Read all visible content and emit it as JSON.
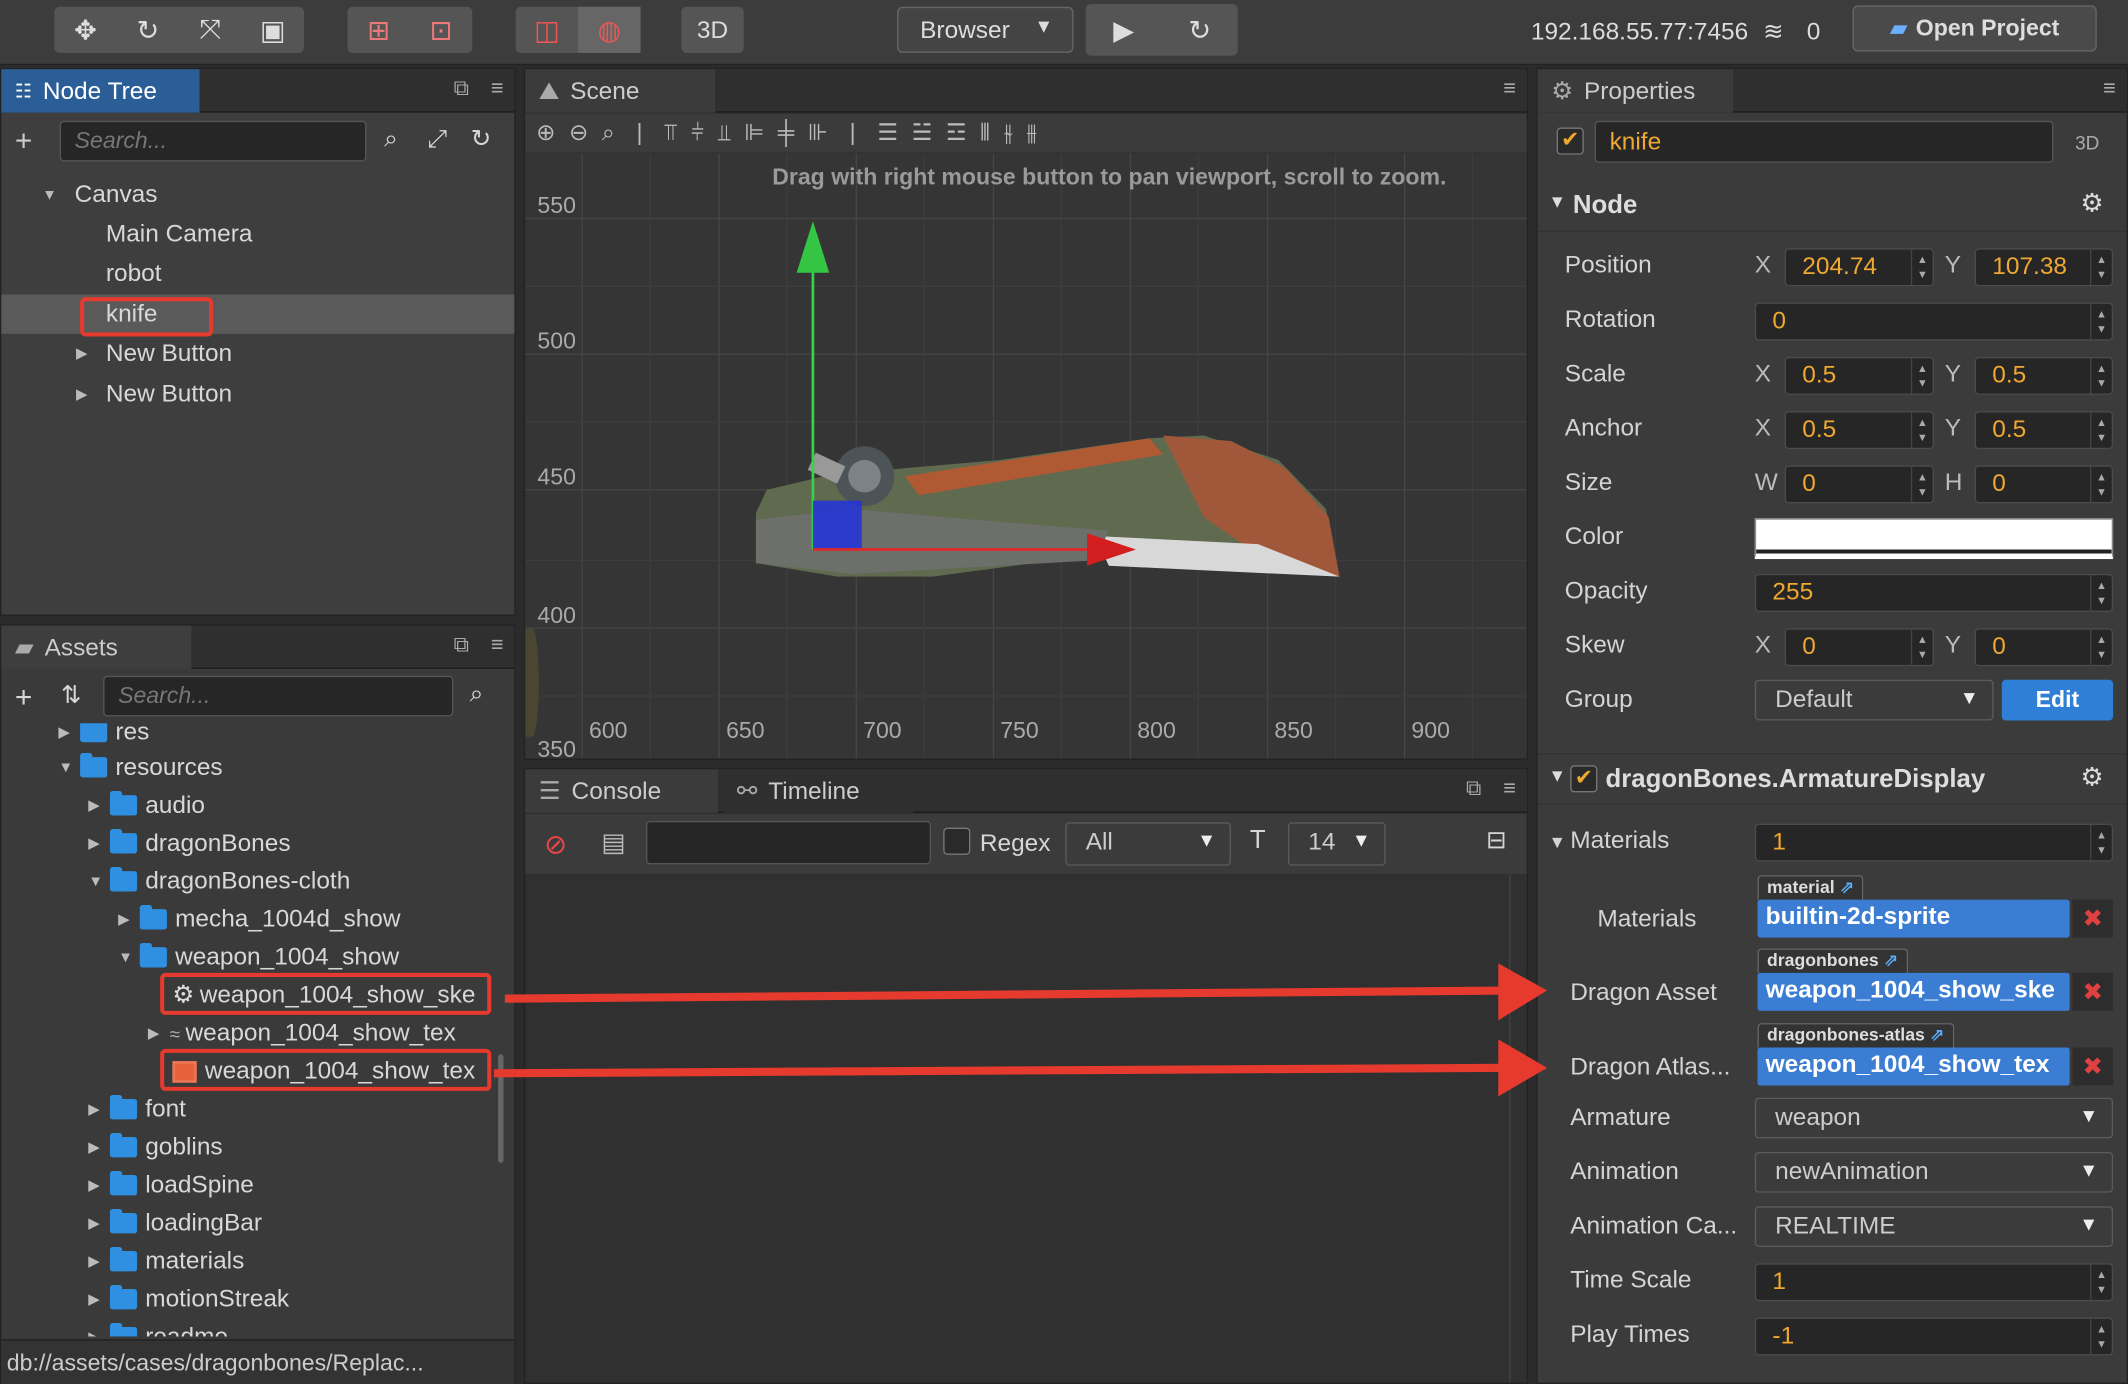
{
  "toolbar": {
    "mode_3d": "3D",
    "preview_target": "Browser",
    "play_icon": "play-icon",
    "refresh_icon": "refresh-icon",
    "ip": "192.168.55.77:7456",
    "client_count": "0",
    "open_project": "Open Project"
  },
  "node_tree": {
    "title": "Node Tree",
    "search_placeholder": "Search...",
    "items": [
      "Canvas",
      "Main Camera",
      "robot",
      "knife",
      "New Button",
      "New Button"
    ]
  },
  "assets": {
    "title": "Assets",
    "search_placeholder": "Search...",
    "items": [
      "res",
      "resources",
      "audio",
      "dragonBones",
      "dragonBones-cloth",
      "mecha_1004d_show",
      "weapon_1004_show",
      "weapon_1004_show_ske",
      "weapon_1004_show_tex",
      "weapon_1004_show_tex",
      "font",
      "goblins",
      "loadSpine",
      "loadingBar",
      "materials",
      "motionStreak",
      "readme"
    ],
    "status_path": "db://assets/cases/dragonbones/Replac..."
  },
  "scene": {
    "title": "Scene",
    "hint": "Drag with right mouse button to pan viewport, scroll to zoom.",
    "y_ticks": [
      "550",
      "500",
      "450",
      "400",
      "350"
    ],
    "x_ticks": [
      "600",
      "650",
      "700",
      "750",
      "800",
      "850",
      "900"
    ]
  },
  "console": {
    "tab_console": "Console",
    "tab_timeline": "Timeline",
    "regex": "Regex",
    "filter": "All",
    "font_size": "14"
  },
  "properties": {
    "title": "Properties",
    "node_name": "knife",
    "mode": "3D",
    "node_section": "Node",
    "position_label": "Position",
    "position_x": "204.74",
    "position_y": "107.38",
    "rotation_label": "Rotation",
    "rotation": "0",
    "scale_label": "Scale",
    "scale_x": "0.5",
    "scale_y": "0.5",
    "anchor_label": "Anchor",
    "anchor_x": "0.5",
    "anchor_y": "0.5",
    "size_label": "Size",
    "size_w": "0",
    "size_h": "0",
    "color_label": "Color",
    "color_value": "#ffffff",
    "opacity_label": "Opacity",
    "opacity": "255",
    "skew_label": "Skew",
    "skew_x": "0",
    "skew_y": "0",
    "group_label": "Group",
    "group": "Default",
    "edit": "Edit",
    "component": "dragonBones.ArmatureDisplay",
    "materials_label": "Materials",
    "materials_count": "1",
    "materials_item_label": "Materials",
    "material_tag": "material",
    "material_value": "builtin-2d-sprite",
    "dragon_asset_label": "Dragon Asset",
    "dragonbones_tag": "dragonbones",
    "dragon_asset": "weapon_1004_show_ske",
    "dragon_atlas_label": "Dragon Atlas...",
    "atlas_tag": "dragonbones-atlas",
    "dragon_atlas": "weapon_1004_show_tex",
    "armature_label": "Armature",
    "armature": "weapon",
    "animation_label": "Animation",
    "animation": "newAnimation",
    "anim_cache_label": "Animation Ca...",
    "anim_cache": "REALTIME",
    "time_scale_label": "Time Scale",
    "time_scale": "1",
    "play_times_label": "Play Times",
    "play_times": "-1",
    "labels": {
      "x": "X",
      "y": "Y",
      "w": "W",
      "h": "H"
    }
  }
}
